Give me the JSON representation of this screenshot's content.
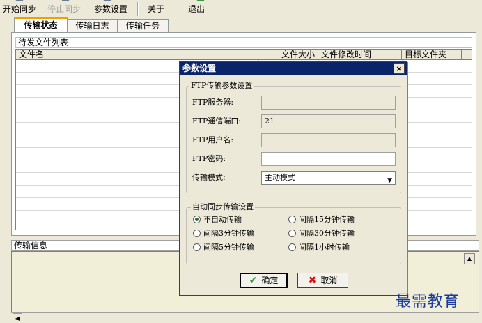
{
  "toolbar": {
    "start_sync": "开始同步",
    "stop_sync": "停止同步",
    "settings": "参数设置",
    "about": "关于",
    "exit": "退出"
  },
  "tabs": [
    "传输状态",
    "传输日志",
    "传输任务"
  ],
  "pending_list": {
    "title": "待发文件列表",
    "columns": [
      "文件名",
      "文件大小",
      "文件修改时间",
      "目标文件夹"
    ]
  },
  "info_section": {
    "title": "传输信息"
  },
  "dialog": {
    "title": "参数设置",
    "close_glyph": "×",
    "ftp_group": "FTP传输参数设置",
    "ftp_server_label": "FTP服务器:",
    "ftp_server_value": "",
    "ftp_port_label": "FTP通信端口:",
    "ftp_port_value": "21",
    "ftp_user_label": "FTP用户名:",
    "ftp_user_value": "",
    "ftp_password_label": "FTP密码:",
    "ftp_password_value": "",
    "mode_label": "传输模式:",
    "mode_value": "主动模式",
    "auto_group": "自动同步传输设置",
    "radio_options": [
      "不自动传输",
      "间隔15分钟传输",
      "间隔3分钟传输",
      "间隔30分钟传输",
      "间隔5分钟传输",
      "间隔1小时传输"
    ],
    "radio_selected": "不自动传输",
    "ok_label": "确定",
    "cancel_label": "取消"
  },
  "watermark": "最需教育",
  "colors": {
    "title_bar": "#0a246a",
    "info_bg": "#f1efd8",
    "active_tab_accent": "#f0a000"
  }
}
